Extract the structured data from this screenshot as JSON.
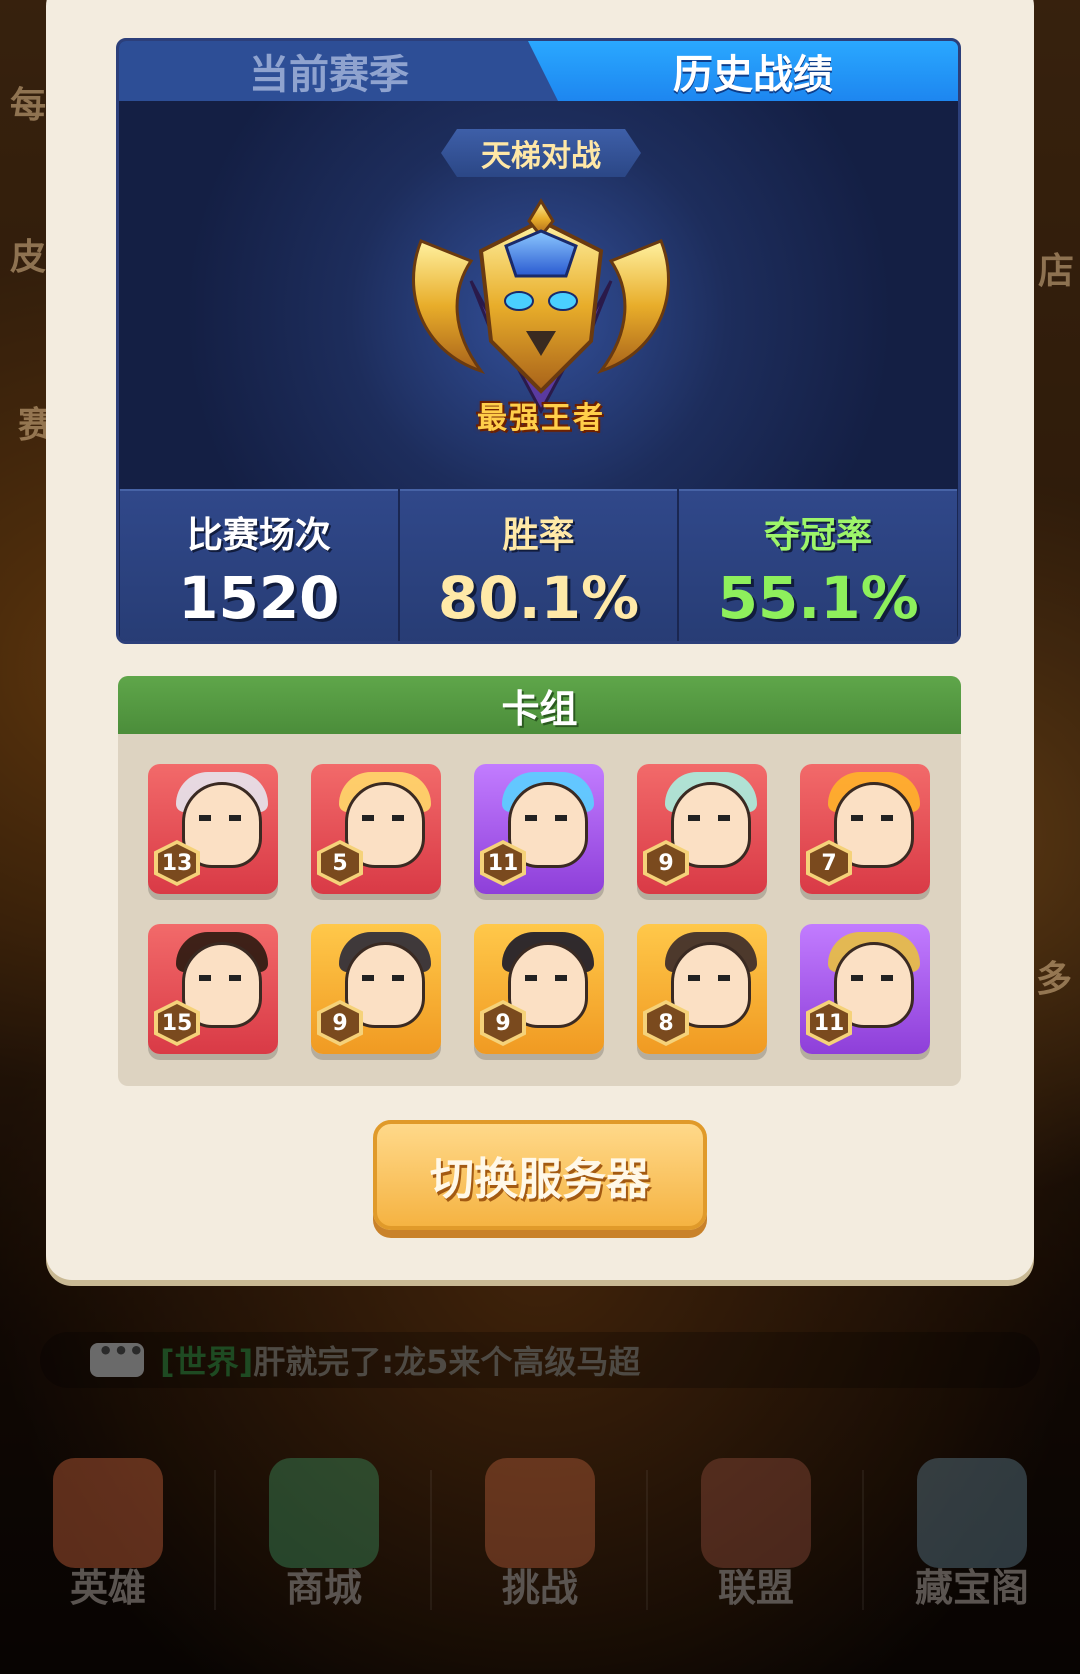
{
  "tabs": {
    "current_season": "当前赛季",
    "history": "历史战绩"
  },
  "record": {
    "mode": "天梯对战",
    "rank_name": "最强王者",
    "stats": [
      {
        "label": "比赛场次",
        "value": "1520"
      },
      {
        "label": "胜率",
        "value": "80.1%"
      },
      {
        "label": "夺冠率",
        "value": "55.1%"
      }
    ]
  },
  "deck": {
    "title": "卡组",
    "cards": [
      {
        "level": "13",
        "frame": "red",
        "icon": "silver-hair-general-portrait"
      },
      {
        "level": "5",
        "frame": "red",
        "icon": "chubby-warrior-portrait"
      },
      {
        "level": "11",
        "frame": "purple",
        "icon": "headphone-girl-portrait"
      },
      {
        "level": "9",
        "frame": "red",
        "icon": "harp-maiden-portrait"
      },
      {
        "level": "7",
        "frame": "red",
        "icon": "angry-yellow-hero-portrait"
      },
      {
        "level": "15",
        "frame": "red",
        "icon": "sword-hero-portrait"
      },
      {
        "level": "9",
        "frame": "gold",
        "icon": "bearded-general-portrait"
      },
      {
        "level": "9",
        "frame": "gold",
        "icon": "masked-warrior-portrait"
      },
      {
        "level": "8",
        "frame": "gold",
        "icon": "court-lady-portrait"
      },
      {
        "level": "11",
        "frame": "purple",
        "icon": "red-helmet-general-portrait"
      }
    ]
  },
  "switch_button": "切换服务器",
  "chat": {
    "channel": "[世界]",
    "message": "肝就完了:龙5来个高级马超"
  },
  "nav": [
    {
      "label": "英雄",
      "icon": "hero-icon"
    },
    {
      "label": "商城",
      "icon": "shop-icon"
    },
    {
      "label": "挑战",
      "icon": "challenge-icon"
    },
    {
      "label": "联盟",
      "icon": "alliance-icon"
    },
    {
      "label": "藏宝阁",
      "icon": "treasure-icon"
    }
  ],
  "side_labels": {
    "left_top": "每",
    "left_mid": "皮",
    "left_low": "赛",
    "right_mid": "店",
    "right_low": "多"
  },
  "colors": {
    "tab_active": "#1d86f0",
    "deck_header": "#4b8d3a",
    "win_rate": "#ffe9a8",
    "champion_rate": "#8ef05c",
    "button": "#f5b342"
  }
}
